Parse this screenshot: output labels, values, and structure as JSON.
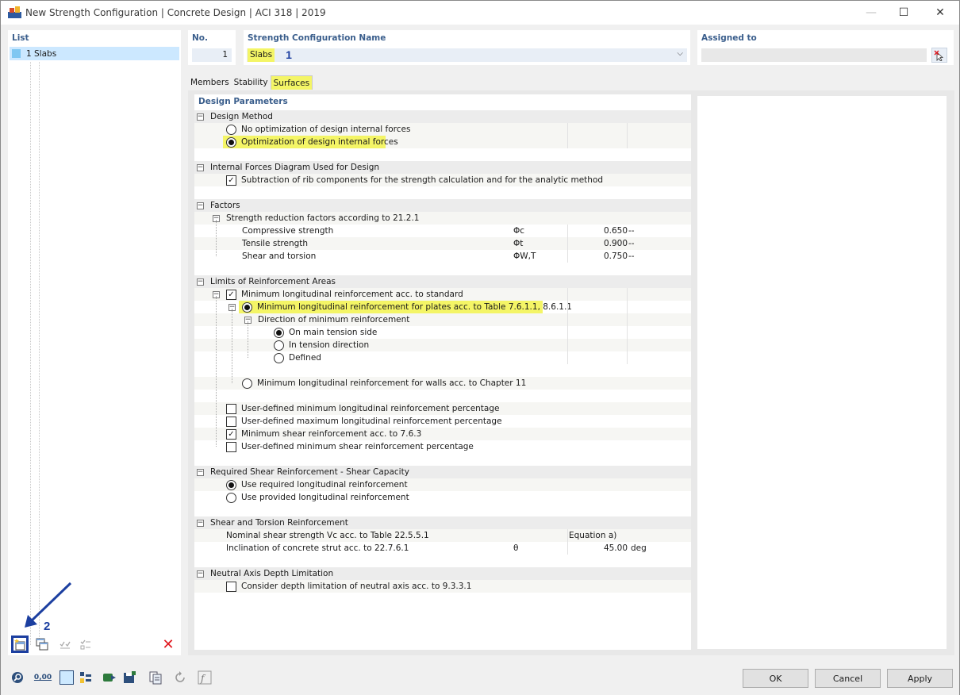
{
  "window": {
    "title": "New Strength Configuration | Concrete Design | ACI 318 | 2019",
    "minimize": "—",
    "maximize": "☐",
    "close": "✕"
  },
  "list": {
    "header": "List",
    "items": [
      {
        "label": "1 Slabs",
        "color": "#7fc7f2"
      }
    ]
  },
  "number": {
    "header": "No.",
    "value": "1"
  },
  "name": {
    "header": "Strength Configuration Name",
    "value": "Slabs"
  },
  "assigned": {
    "header": "Assigned to",
    "value": ""
  },
  "annotations": {
    "step1": "1",
    "step2": "2"
  },
  "tabs": [
    {
      "label": "Members",
      "active": false
    },
    {
      "label": "Stability",
      "active": false
    },
    {
      "label": "Surfaces",
      "active": true
    }
  ],
  "params": {
    "title": "Design Parameters",
    "design_method": {
      "label": "Design Method",
      "opt1": "No optimization of design internal forces",
      "opt2": "Optimization of design internal forces"
    },
    "forces_diagram": {
      "label": "Internal Forces Diagram Used for Design",
      "opt1": "Subtraction of rib components for the strength calculation and for the analytic method"
    },
    "factors": {
      "label": "Factors",
      "sub": "Strength reduction factors according to 21.2.1",
      "rows": [
        {
          "label": "Compressive strength",
          "symbol": "Φc",
          "value": "0.650",
          "unit": "--"
        },
        {
          "label": "Tensile strength",
          "symbol": "Φt",
          "value": "0.900",
          "unit": "--"
        },
        {
          "label": "Shear and torsion",
          "symbol": "ΦW,T",
          "value": "0.750",
          "unit": "--"
        }
      ]
    },
    "limits": {
      "label": "Limits of Reinforcement Areas",
      "min_long": "Minimum longitudinal reinforcement acc. to standard",
      "min_plates": "Minimum longitudinal reinforcement for plates acc. to Table 7.6.1.1, 8.6.1.1",
      "direction": "Direction of minimum reinforcement",
      "dir1": "On main tension side",
      "dir2": "In tension direction",
      "dir3": "Defined",
      "min_walls": "Minimum longitudinal reinforcement for walls acc. to Chapter 11",
      "user_min": "User-defined minimum longitudinal reinforcement percentage",
      "user_max": "User-defined maximum longitudinal reinforcement percentage",
      "min_shear": "Minimum shear reinforcement acc. to 7.6.3",
      "user_min_shear": "User-defined minimum shear reinforcement percentage"
    },
    "shear_capacity": {
      "label": "Required Shear Reinforcement - Shear Capacity",
      "opt1": "Use required longitudinal reinforcement",
      "opt2": "Use provided longitudinal reinforcement"
    },
    "shear_torsion": {
      "label": "Shear and Torsion Reinforcement",
      "nominal": "Nominal shear strength Vc acc. to Table 22.5.5.1",
      "nominal_value": "Equation a)",
      "inclination": "Inclination of concrete strut acc. to 22.7.6.1",
      "inclination_symbol": "θ",
      "inclination_value": "45.00",
      "inclination_unit": "deg"
    },
    "neutral_axis": {
      "label": "Neutral Axis Depth Limitation",
      "opt1": "Consider depth limitation of neutral axis acc. to 9.3.3.1"
    }
  },
  "buttons": {
    "ok": "OK",
    "cancel": "Cancel",
    "apply": "Apply"
  },
  "bottom_icons": {
    "zero_value": "0,00"
  },
  "colors": {
    "highlight": "#f4f566",
    "header_blue": "#3a5e8c",
    "annotation_blue": "#1c3fa0",
    "delete_red": "#e0171e"
  }
}
